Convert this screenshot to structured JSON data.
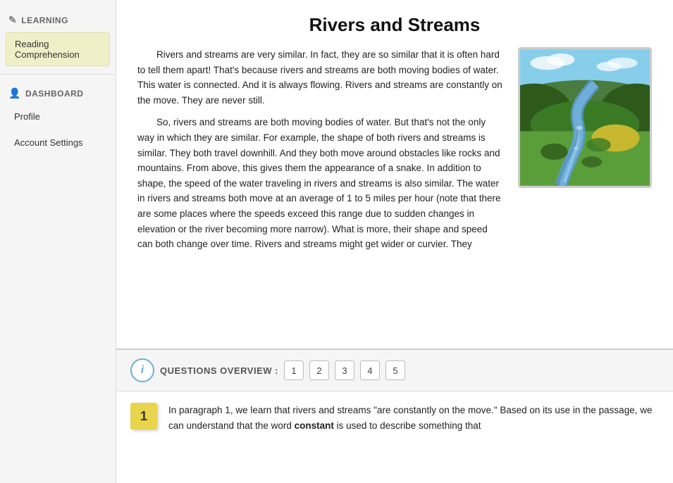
{
  "sidebar": {
    "learning_header": "LEARNING",
    "learning_icon": "📚",
    "dashboard_header": "DASHBOARD",
    "dashboard_icon": "👤",
    "nav_items": [
      {
        "id": "reading-comprehension",
        "label": "Reading\nComprehension",
        "active": true
      },
      {
        "id": "profile",
        "label": "Profile",
        "active": false
      },
      {
        "id": "account-settings",
        "label": "Account Settings",
        "active": false
      }
    ]
  },
  "reading": {
    "title": "Rivers and Streams",
    "paragraphs": [
      "Rivers and streams are very similar. In fact, they are so similar that it is often hard to tell them apart! That's because rivers and streams are both moving bodies of water. This water is connected. And it is always flowing. Rivers and streams are constantly on the move. They are never still.",
      "So, rivers and streams are both moving bodies of water. But that's not the only way in which they are similar. For example, the shape of both rivers and streams is similar. They both travel downhill. And they both move around obstacles like rocks and mountains. From above, this gives them the appearance of a snake. In addition to shape, the speed of the water traveling in rivers and streams is also similar. The water in rivers and streams both move at an average of 1 to 5 miles per hour (note that there are some places where the speeds exceed this range due to sudden changes in elevation or the river becoming more narrow). What is more, their shape and speed can both change over time. Rivers and streams might get wider or curvier. They"
    ],
    "image_alt": "Aerial view of a river winding through green hills and valleys"
  },
  "questions_overview": {
    "label": "QUESTIONS OVERVIEW :",
    "info_icon_text": "i",
    "question_numbers": [
      "1",
      "2",
      "3",
      "4",
      "5"
    ]
  },
  "current_question": {
    "number": "1",
    "text": "In paragraph 1, we learn that rivers and streams \"are constantly on the move.\" Based on its use in the passage, we can understand that the word",
    "bold_word": "constant",
    "continuation": "is used to describe something that"
  }
}
